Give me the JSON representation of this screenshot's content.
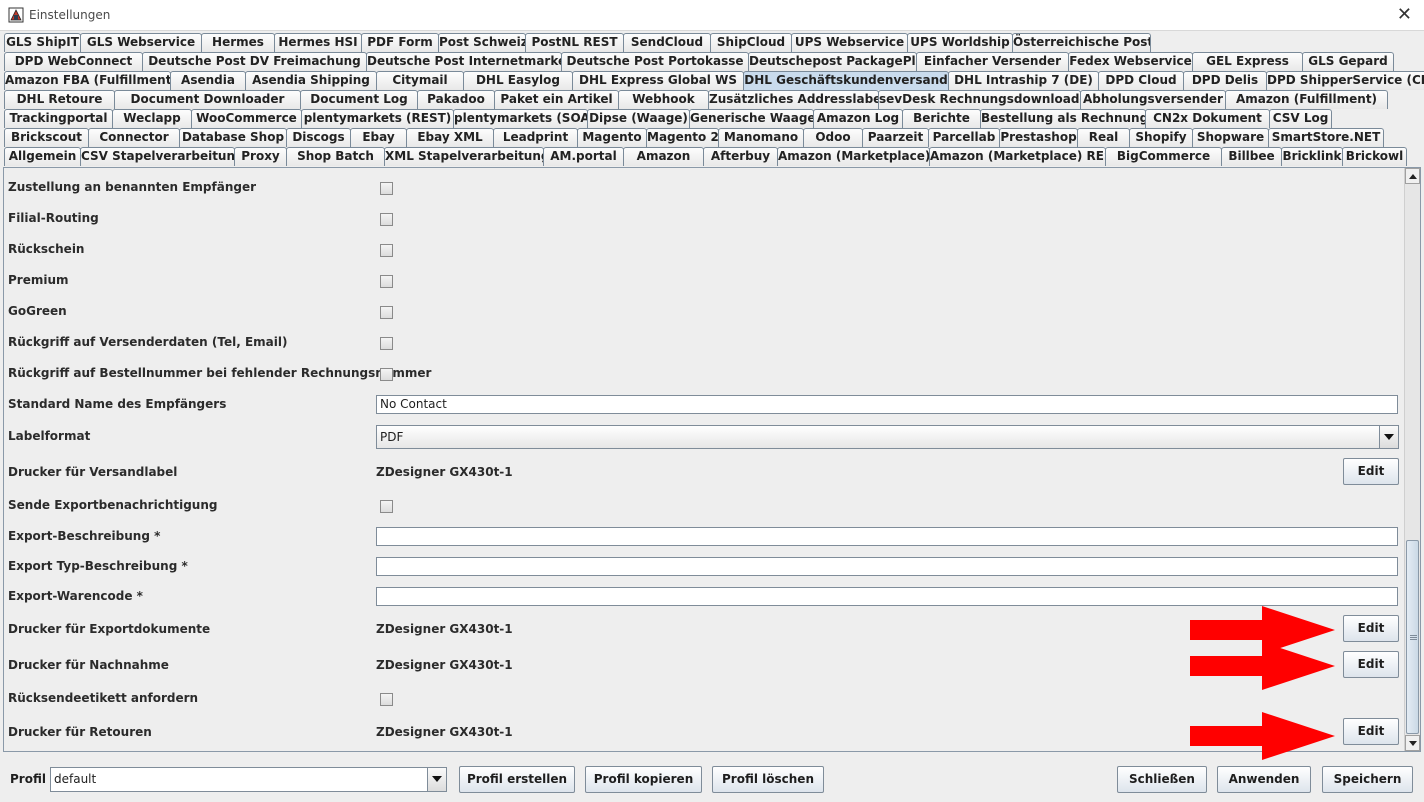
{
  "window": {
    "title": "Einstellungen"
  },
  "tab_rows": [
    [
      "GLS ShipIT",
      "GLS Webservice",
      "Hermes",
      "Hermes HSI",
      "PDF Form",
      "Post Schweiz",
      "PostNL REST",
      "SendCloud",
      "ShipCloud",
      "UPS Webservice",
      "UPS Worldship",
      "Österreichische Post"
    ],
    [
      "DPD WebConnect",
      "Deutsche Post DV Freimachung",
      "Deutsche Post Internetmarke",
      "Deutsche Post Portokasse",
      "Deutschepost PackagePlus",
      "Einfacher Versender",
      "Fedex Webservice",
      "GEL Express",
      "GLS Gepard"
    ],
    [
      "Amazon FBA (Fulfillment)",
      "Asendia",
      "Asendia Shipping",
      "Citymail",
      "DHL Easylog",
      "DHL Express Global WS",
      "DHL Geschäftskundenversand",
      "DHL Intraship 7 (DE)",
      "DPD Cloud",
      "DPD Delis",
      "DPD ShipperService (CH)"
    ],
    [
      "DHL Retoure",
      "Document Downloader",
      "Document Log",
      "Pakadoo",
      "Paket ein Artikel",
      "Webhook",
      "Zusätzliches Addresslabel",
      "sevDesk Rechnungsdownloader",
      "Abholungsversender",
      "Amazon (Fulfillment)"
    ],
    [
      "Trackingportal",
      "Weclapp",
      "WooCommerce",
      "plentymarkets (REST)",
      "plentymarkets (SOAP)",
      "Dipse (Waage)",
      "Generische Waage",
      "Amazon Log",
      "Berichte",
      "Bestellung als Rechnung",
      "CN2x Dokument",
      "CSV Log"
    ],
    [
      "Brickscout",
      "Connector",
      "Database Shop",
      "Discogs",
      "Ebay",
      "Ebay XML",
      "Leadprint",
      "Magento",
      "Magento 2",
      "Manomano",
      "Odoo",
      "Paarzeit",
      "Parcellab",
      "Prestashop",
      "Real",
      "Shopify",
      "Shopware",
      "SmartStore.NET"
    ],
    [
      "Allgemein",
      "CSV Stapelverarbeitung",
      "Proxy",
      "Shop Batch",
      "XML Stapelverarbeitung",
      "AM.portal",
      "Amazon",
      "Afterbuy",
      "Amazon (Marketplace)",
      "Amazon (Marketplace) REST",
      "BigCommerce",
      "Billbee",
      "Bricklink",
      "Brickowl"
    ]
  ],
  "active_tab": "DHL Geschäftskundenversand",
  "settings": {
    "zustellung": "Zustellung an benannten Empfänger",
    "filial": "Filial-Routing",
    "rueckschein": "Rückschein",
    "premium": "Premium",
    "gogreen": "GoGreen",
    "rueckgriff_tel": "Rückgriff auf Versenderdaten (Tel, Email)",
    "rueckgriff_best": "Rückgriff auf Bestellnummer bei fehlender Rechnungsnummer",
    "standard_name_label": "Standard Name des Empfängers",
    "standard_name_value": "No Contact",
    "labelformat_label": "Labelformat",
    "labelformat_value": "PDF",
    "drucker_versand_label": "Drucker für Versandlabel",
    "drucker_versand_value": "ZDesigner GX430t-1",
    "sende_export": "Sende Exportbenachrichtigung",
    "export_beschreibung": "Export-Beschreibung *",
    "export_typ": "Export Typ-Beschreibung *",
    "export_warencode": "Export-Warencode *",
    "drucker_export_label": "Drucker für Exportdokumente",
    "drucker_export_value": "ZDesigner GX430t-1",
    "drucker_nachnahme_label": "Drucker für Nachnahme",
    "drucker_nachnahme_value": "ZDesigner GX430t-1",
    "ruecksende": "Rücksendeetikett anfordern",
    "drucker_retouren_label": "Drucker für Retouren",
    "drucker_retouren_value": "ZDesigner GX430t-1",
    "edit_label": "Edit"
  },
  "bottom": {
    "profil_label": "Profil",
    "profil_value": "default",
    "profil_erstellen": "Profil erstellen",
    "profil_kopieren": "Profil kopieren",
    "profil_loeschen": "Profil löschen",
    "schliessen": "Schließen",
    "anwenden": "Anwenden",
    "speichern": "Speichern"
  },
  "colors": {
    "active_tab": "#c9dbed",
    "annotation_arrow": "#ff0000"
  }
}
